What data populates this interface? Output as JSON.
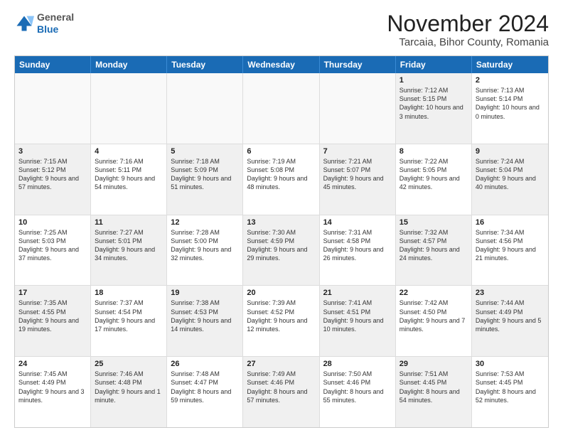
{
  "header": {
    "logo_general": "General",
    "logo_blue": "Blue",
    "main_title": "November 2024",
    "subtitle": "Tarcaia, Bihor County, Romania"
  },
  "calendar": {
    "days_of_week": [
      "Sunday",
      "Monday",
      "Tuesday",
      "Wednesday",
      "Thursday",
      "Friday",
      "Saturday"
    ],
    "rows": [
      [
        {
          "day": "",
          "info": "",
          "empty": true
        },
        {
          "day": "",
          "info": "",
          "empty": true
        },
        {
          "day": "",
          "info": "",
          "empty": true
        },
        {
          "day": "",
          "info": "",
          "empty": true
        },
        {
          "day": "",
          "info": "",
          "empty": true
        },
        {
          "day": "1",
          "info": "Sunrise: 7:12 AM\nSunset: 5:15 PM\nDaylight: 10 hours and 3 minutes.",
          "shaded": true
        },
        {
          "day": "2",
          "info": "Sunrise: 7:13 AM\nSunset: 5:14 PM\nDaylight: 10 hours and 0 minutes.",
          "shaded": false
        }
      ],
      [
        {
          "day": "3",
          "info": "Sunrise: 7:15 AM\nSunset: 5:12 PM\nDaylight: 9 hours and 57 minutes.",
          "shaded": true
        },
        {
          "day": "4",
          "info": "Sunrise: 7:16 AM\nSunset: 5:11 PM\nDaylight: 9 hours and 54 minutes.",
          "shaded": false
        },
        {
          "day": "5",
          "info": "Sunrise: 7:18 AM\nSunset: 5:09 PM\nDaylight: 9 hours and 51 minutes.",
          "shaded": true
        },
        {
          "day": "6",
          "info": "Sunrise: 7:19 AM\nSunset: 5:08 PM\nDaylight: 9 hours and 48 minutes.",
          "shaded": false
        },
        {
          "day": "7",
          "info": "Sunrise: 7:21 AM\nSunset: 5:07 PM\nDaylight: 9 hours and 45 minutes.",
          "shaded": true
        },
        {
          "day": "8",
          "info": "Sunrise: 7:22 AM\nSunset: 5:05 PM\nDaylight: 9 hours and 42 minutes.",
          "shaded": false
        },
        {
          "day": "9",
          "info": "Sunrise: 7:24 AM\nSunset: 5:04 PM\nDaylight: 9 hours and 40 minutes.",
          "shaded": true
        }
      ],
      [
        {
          "day": "10",
          "info": "Sunrise: 7:25 AM\nSunset: 5:03 PM\nDaylight: 9 hours and 37 minutes.",
          "shaded": false
        },
        {
          "day": "11",
          "info": "Sunrise: 7:27 AM\nSunset: 5:01 PM\nDaylight: 9 hours and 34 minutes.",
          "shaded": true
        },
        {
          "day": "12",
          "info": "Sunrise: 7:28 AM\nSunset: 5:00 PM\nDaylight: 9 hours and 32 minutes.",
          "shaded": false
        },
        {
          "day": "13",
          "info": "Sunrise: 7:30 AM\nSunset: 4:59 PM\nDaylight: 9 hours and 29 minutes.",
          "shaded": true
        },
        {
          "day": "14",
          "info": "Sunrise: 7:31 AM\nSunset: 4:58 PM\nDaylight: 9 hours and 26 minutes.",
          "shaded": false
        },
        {
          "day": "15",
          "info": "Sunrise: 7:32 AM\nSunset: 4:57 PM\nDaylight: 9 hours and 24 minutes.",
          "shaded": true
        },
        {
          "day": "16",
          "info": "Sunrise: 7:34 AM\nSunset: 4:56 PM\nDaylight: 9 hours and 21 minutes.",
          "shaded": false
        }
      ],
      [
        {
          "day": "17",
          "info": "Sunrise: 7:35 AM\nSunset: 4:55 PM\nDaylight: 9 hours and 19 minutes.",
          "shaded": true
        },
        {
          "day": "18",
          "info": "Sunrise: 7:37 AM\nSunset: 4:54 PM\nDaylight: 9 hours and 17 minutes.",
          "shaded": false
        },
        {
          "day": "19",
          "info": "Sunrise: 7:38 AM\nSunset: 4:53 PM\nDaylight: 9 hours and 14 minutes.",
          "shaded": true
        },
        {
          "day": "20",
          "info": "Sunrise: 7:39 AM\nSunset: 4:52 PM\nDaylight: 9 hours and 12 minutes.",
          "shaded": false
        },
        {
          "day": "21",
          "info": "Sunrise: 7:41 AM\nSunset: 4:51 PM\nDaylight: 9 hours and 10 minutes.",
          "shaded": true
        },
        {
          "day": "22",
          "info": "Sunrise: 7:42 AM\nSunset: 4:50 PM\nDaylight: 9 hours and 7 minutes.",
          "shaded": false
        },
        {
          "day": "23",
          "info": "Sunrise: 7:44 AM\nSunset: 4:49 PM\nDaylight: 9 hours and 5 minutes.",
          "shaded": true
        }
      ],
      [
        {
          "day": "24",
          "info": "Sunrise: 7:45 AM\nSunset: 4:49 PM\nDaylight: 9 hours and 3 minutes.",
          "shaded": false
        },
        {
          "day": "25",
          "info": "Sunrise: 7:46 AM\nSunset: 4:48 PM\nDaylight: 9 hours and 1 minute.",
          "shaded": true
        },
        {
          "day": "26",
          "info": "Sunrise: 7:48 AM\nSunset: 4:47 PM\nDaylight: 8 hours and 59 minutes.",
          "shaded": false
        },
        {
          "day": "27",
          "info": "Sunrise: 7:49 AM\nSunset: 4:46 PM\nDaylight: 8 hours and 57 minutes.",
          "shaded": true
        },
        {
          "day": "28",
          "info": "Sunrise: 7:50 AM\nSunset: 4:46 PM\nDaylight: 8 hours and 55 minutes.",
          "shaded": false
        },
        {
          "day": "29",
          "info": "Sunrise: 7:51 AM\nSunset: 4:45 PM\nDaylight: 8 hours and 54 minutes.",
          "shaded": true
        },
        {
          "day": "30",
          "info": "Sunrise: 7:53 AM\nSunset: 4:45 PM\nDaylight: 8 hours and 52 minutes.",
          "shaded": false
        }
      ]
    ]
  }
}
